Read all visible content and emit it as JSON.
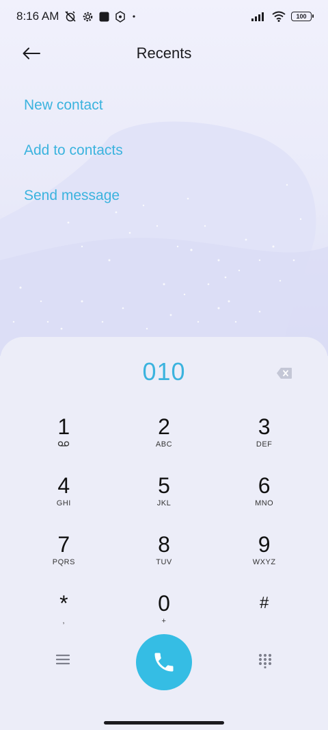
{
  "status_bar": {
    "time": "8:16 AM",
    "battery_level": "100"
  },
  "header": {
    "title": "Recents"
  },
  "actions": [
    {
      "label": "New contact"
    },
    {
      "label": "Add to contacts"
    },
    {
      "label": "Send message"
    }
  ],
  "dialer": {
    "number": "010",
    "keys": [
      {
        "digit": "1",
        "letters": "",
        "voicemail": true
      },
      {
        "digit": "2",
        "letters": "ABC"
      },
      {
        "digit": "3",
        "letters": "DEF"
      },
      {
        "digit": "4",
        "letters": "GHI"
      },
      {
        "digit": "5",
        "letters": "JKL"
      },
      {
        "digit": "6",
        "letters": "MNO"
      },
      {
        "digit": "7",
        "letters": "PQRS"
      },
      {
        "digit": "8",
        "letters": "TUV"
      },
      {
        "digit": "9",
        "letters": "WXYZ"
      },
      {
        "digit": "*",
        "letters": ","
      },
      {
        "digit": "0",
        "letters": "+"
      },
      {
        "digit": "#",
        "letters": ""
      }
    ]
  },
  "icons": {
    "back": "back-arrow-icon",
    "backspace": "backspace-icon",
    "menu": "menu-icon",
    "call": "phone-icon",
    "keypad": "dialpad-icon"
  },
  "colors": {
    "accent": "#3bb3de",
    "call_button": "#35bde4",
    "panel": "#ecedf8"
  }
}
